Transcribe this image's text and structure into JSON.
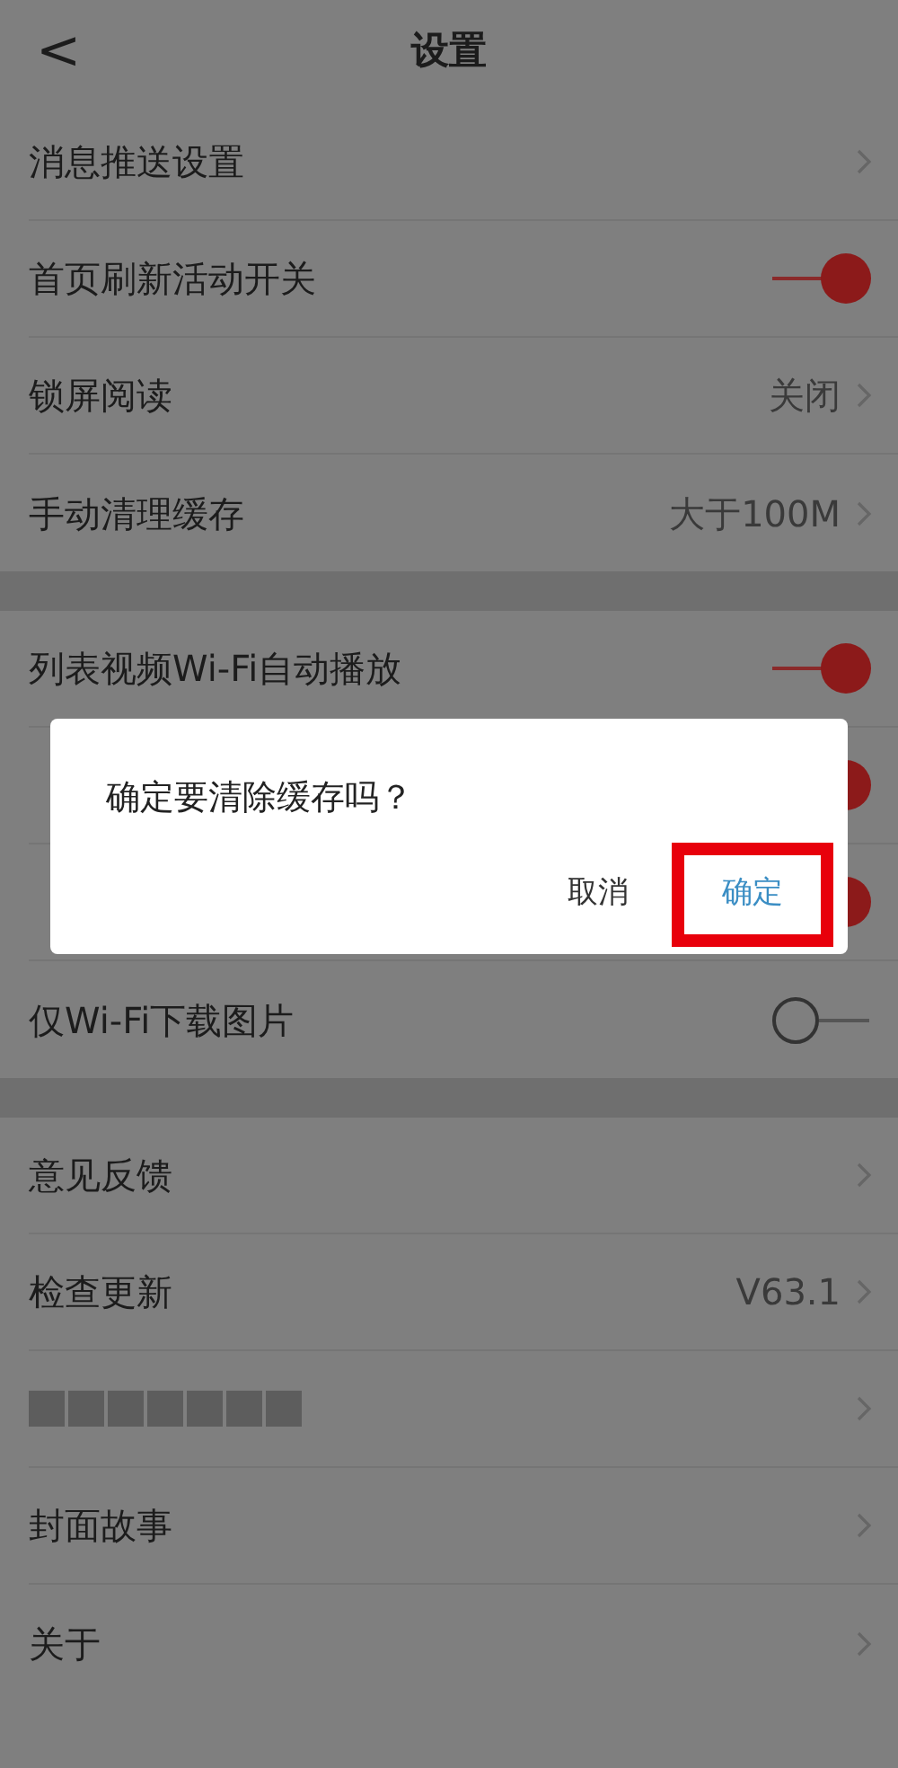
{
  "header": {
    "back": "<",
    "title": "设置"
  },
  "sections": [
    {
      "rows": [
        {
          "kind": "link",
          "label": "消息推送设置"
        },
        {
          "kind": "toggle",
          "label": "首页刷新活动开关",
          "on": true
        },
        {
          "kind": "link",
          "label": "锁屏阅读",
          "value": "关闭"
        },
        {
          "kind": "link",
          "label": "手动清理缓存",
          "value": "大于100M"
        }
      ]
    },
    {
      "rows": [
        {
          "kind": "toggle",
          "label": "列表视频Wi-Fi自动播放",
          "on": true
        },
        {
          "kind": "toggle",
          "on": true
        },
        {
          "kind": "toggle",
          "on": true
        },
        {
          "kind": "toggle",
          "label": "仅Wi-Fi下载图片",
          "on": false
        }
      ]
    },
    {
      "rows": [
        {
          "kind": "link",
          "label": "意见反馈"
        },
        {
          "kind": "link",
          "label": "检查更新",
          "value": "V63.1"
        },
        {
          "kind": "blurred"
        },
        {
          "kind": "link",
          "label": "封面故事"
        },
        {
          "kind": "link",
          "label": "关于"
        }
      ]
    }
  ],
  "dialog": {
    "message": "确定要清除缓存吗？",
    "buttons": [
      {
        "label": "取消",
        "primary": false,
        "highlighted": false
      },
      {
        "label": "确定",
        "primary": true,
        "highlighted": true
      }
    ]
  }
}
